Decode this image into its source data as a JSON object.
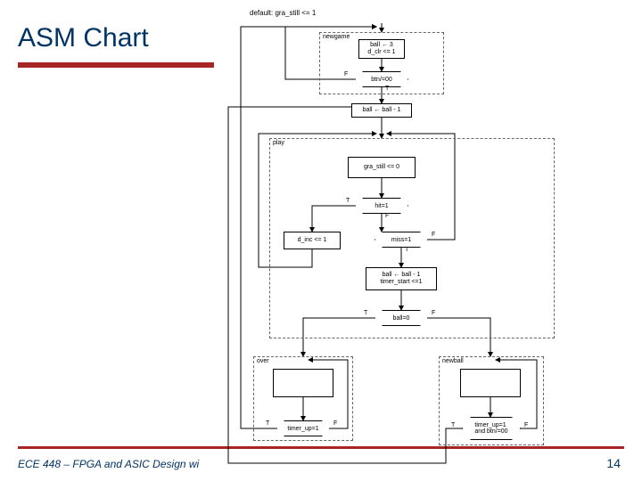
{
  "title": "ASM Chart",
  "footer": "ECE 448 – FPGA and ASIC Design wi",
  "page_number": "14",
  "default_label": "default: gra_still <= 1",
  "states": {
    "newgame": {
      "title": "newgame",
      "box": "ball ← 3\nd_clr <= 1",
      "decision": "btn/=00",
      "t": "T",
      "f": "F"
    },
    "ball_dec": "ball ← ball - 1",
    "play": {
      "title": "play",
      "box": "gra_still <= 0",
      "hit": "hit=1",
      "miss": "miss=1",
      "dinc": "d_inc <= 1",
      "ballbox": "ball ← ball - 1\ntimer_start <=1",
      "ball0": "ball=0",
      "t": "T",
      "f": "F"
    },
    "over": {
      "title": "over",
      "timer": "timer_up=1",
      "t": "T",
      "f": "F"
    },
    "newball": {
      "title": "newball",
      "cond": "timer_up=1\nand btn/=00",
      "t": "T",
      "f": "F"
    }
  }
}
